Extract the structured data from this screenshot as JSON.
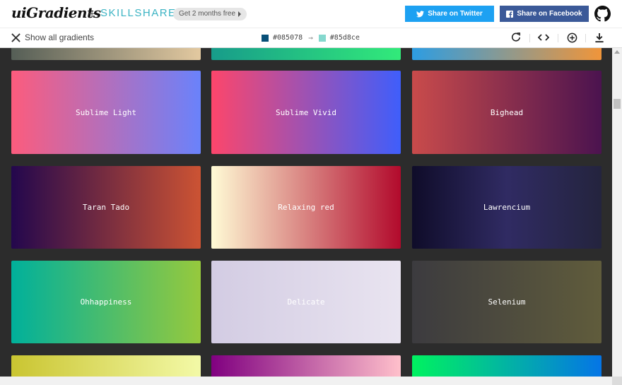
{
  "header": {
    "logo": "uiGradients",
    "plus": "+",
    "partner": "SKILLSHARE",
    "promo": "Get 2 months free",
    "twitter_label": "Share on Twitter",
    "facebook_label": "Share on Facebook"
  },
  "toolbar": {
    "show_all": "Show all gradients",
    "color_from": "#085078",
    "color_to": "#85d8ce",
    "arrow": "→"
  },
  "gradients": [
    {
      "name": "",
      "from": "#555e56",
      "to": "#e3c9a0"
    },
    {
      "name": "",
      "from": "#179c8a",
      "to": "#32ea7a"
    },
    {
      "name": "",
      "from": "#2d9de2",
      "to": "#f0953a"
    },
    {
      "name": "Sublime Light",
      "from": "#fc5c7d",
      "to": "#6a82fb"
    },
    {
      "name": "Sublime Vivid",
      "from": "#fc466b",
      "to": "#3f5efb"
    },
    {
      "name": "Bighead",
      "from": "#c94b4b",
      "to": "#4b134f"
    },
    {
      "name": "Taran Tado",
      "from": "#23074d",
      "to": "#cc5333"
    },
    {
      "name": "Relaxing red",
      "from": "#fffbd5",
      "to": "#b20a2c"
    },
    {
      "name": "Lawrencium",
      "from": "#0f0c29",
      "via": "#302b63",
      "to": "#24243e"
    },
    {
      "name": "Ohhappiness",
      "from": "#00b09b",
      "to": "#96c93d"
    },
    {
      "name": "Delicate",
      "from": "#d3cce3",
      "to": "#e9e4f0"
    },
    {
      "name": "Selenium",
      "from": "#3c3b3f",
      "to": "#605c3c"
    },
    {
      "name": "",
      "from": "#cac531",
      "to": "#f3f9a7"
    },
    {
      "name": "",
      "from": "#800080",
      "to": "#ffc0cb"
    },
    {
      "name": "",
      "from": "#00f260",
      "to": "#0575e6"
    }
  ]
}
